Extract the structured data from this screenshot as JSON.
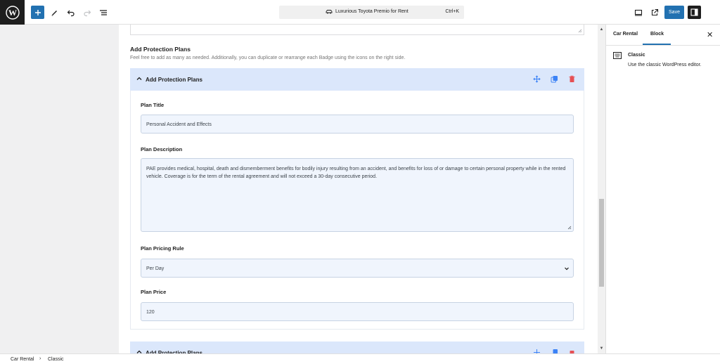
{
  "toolbar": {
    "document_title": "Luxurious Toyota Premio for Rent",
    "shortcut": "Ctrl+K",
    "save_label": "Save"
  },
  "settings": {
    "tabs": [
      {
        "label": "Car Rental",
        "active": false
      },
      {
        "label": "Block",
        "active": true
      }
    ],
    "block_name": "Classic",
    "block_description": "Use the classic WordPress editor."
  },
  "section": {
    "title": "Add Protection Plans",
    "description": "Feel free to add as many as needed. Additionally, you can duplicate or rearrange each Badge using the icons on the right side."
  },
  "panels": [
    {
      "header": "Add Protection Plans",
      "expanded": true,
      "plan_title_label": "Plan Title",
      "plan_title_value": "Personal Accident and Effects",
      "plan_description_label": "Plan Description",
      "plan_description_value": "PAE provides medical, hospital, death and dismemberment benefits for bodily injury resulting from an accident, and benefits for loss of or damage to certain personal property while in the rented vehicle. Coverage is for the term of the rental agreement and will not exceed a 30-day consecutive period.",
      "pricing_rule_label": "Plan Pricing Rule",
      "pricing_rule_value": "Per Day",
      "price_label": "Plan Price",
      "price_value": "120"
    },
    {
      "header": "Add Protection Plans",
      "expanded": false
    }
  ],
  "breadcrumb": [
    "Car Rental",
    "Classic"
  ],
  "colors": {
    "accent": "#2271b1",
    "panel_header": "#dbe7fb",
    "field_bg": "#f0f5fd",
    "delete": "#e65054",
    "action_icon": "#3b82f6"
  },
  "icons": {
    "logo": "wordpress-logo-icon",
    "add": "plus-icon",
    "tools": "pencil-icon",
    "undo": "undo-icon",
    "redo": "redo-icon",
    "outline": "list-view-icon",
    "view": "desktop-icon",
    "preview": "external-link-icon",
    "sidebar": "sidebar-toggle-icon",
    "move": "move-icon",
    "duplicate": "duplicate-icon",
    "delete": "trash-icon"
  }
}
